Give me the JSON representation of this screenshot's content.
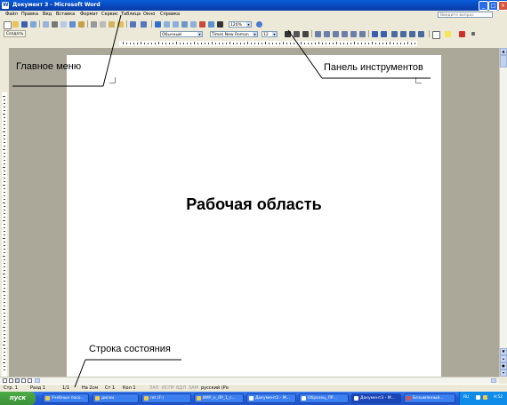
{
  "window": {
    "title": "Документ 3 - Microsoft Word",
    "minimize": "_",
    "maximize": "□",
    "close": "×"
  },
  "menu": {
    "items": [
      "Файл",
      "Правка",
      "Вид",
      "Вставка",
      "Формат",
      "Сервис",
      "Таблица",
      "Окно",
      "Справка"
    ],
    "help_placeholder": "Введите вопрос"
  },
  "toolbar": {
    "zoom": "120%",
    "create_button": "Создать",
    "style": "Обычный",
    "font": "Times New Roman",
    "size": "12"
  },
  "document": {
    "workspace_label": "Рабочая область"
  },
  "annotations": {
    "main_menu": "Главное меню",
    "toolbar_panel": "Панель инструментов",
    "status_bar": "Строка состояния"
  },
  "statusbar": {
    "page": "Стр. 1",
    "section": "Разд 1",
    "pages": "1/1",
    "at": "На  2см",
    "line": "Ст  1",
    "col": "Кол  1",
    "rec": "ЗАП",
    "trk": "ИСПР",
    "ext": "ВДЛ",
    "ovr": "ЗАМ",
    "language": "русский (Ро"
  },
  "taskbar": {
    "start": "пуск",
    "tasks": [
      "Учебные посо...",
      "диски",
      "ret (F:)",
      "ИИУ_к_ЛР_1_с...",
      "Документ2 - M...",
      "Образец_ЛР...",
      "Документ3 - M...",
      "Безымянный..."
    ],
    "active_index": 6,
    "lang": "RU",
    "time": "9:52"
  }
}
